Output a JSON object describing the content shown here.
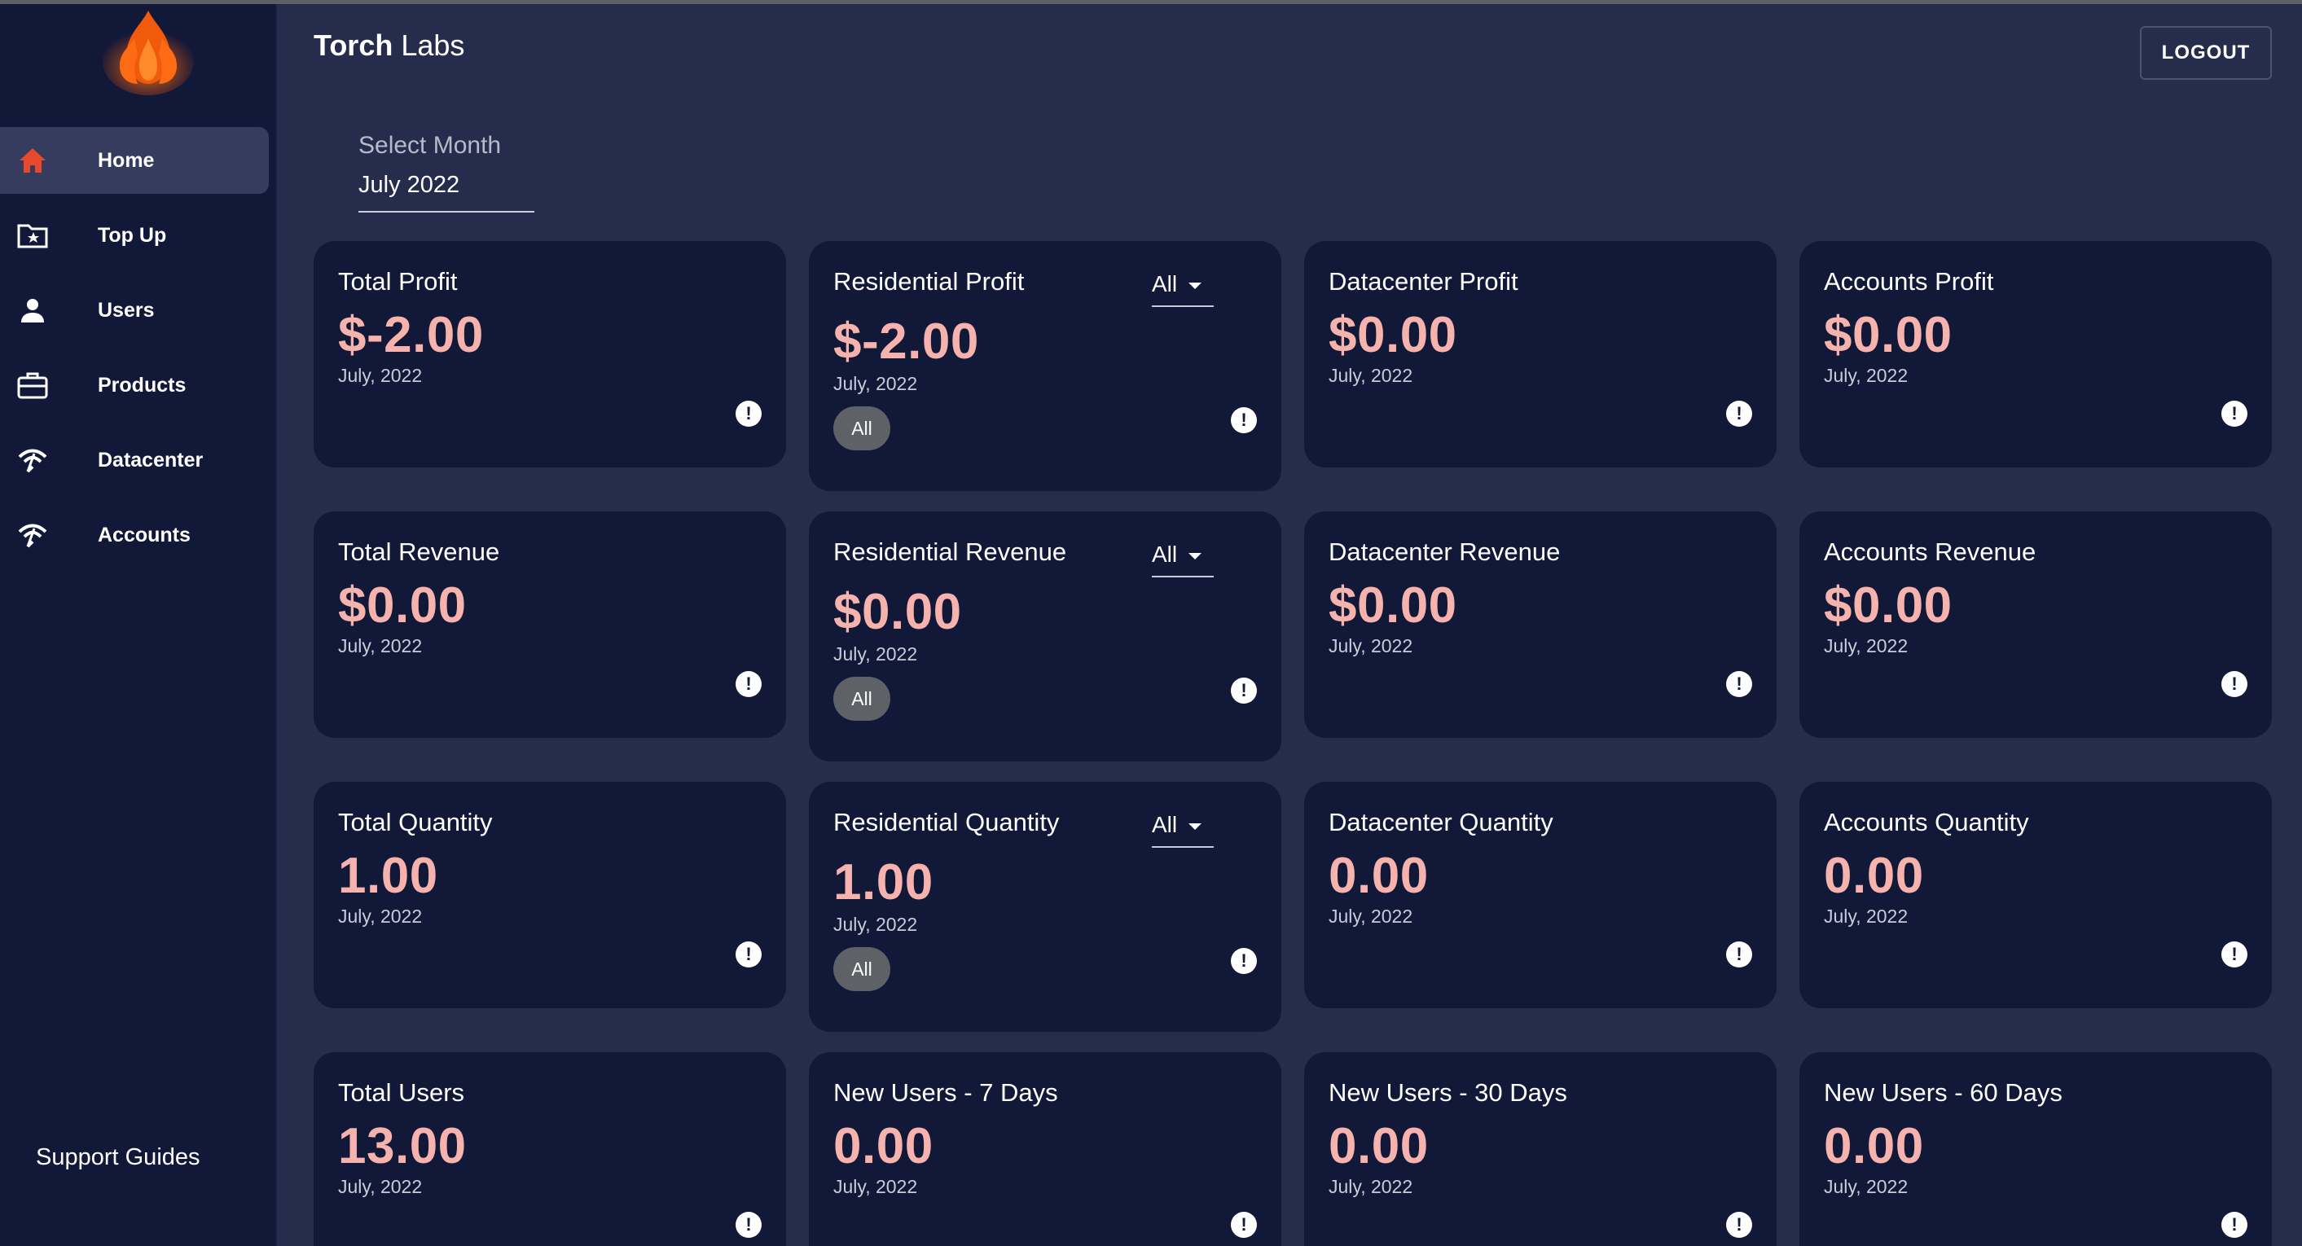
{
  "brand": {
    "bold": "Torch",
    "rest": " Labs"
  },
  "header": {
    "logout_label": "LOGOUT"
  },
  "sidebar": {
    "items": [
      {
        "label": "Home",
        "icon": "home-icon",
        "active": true
      },
      {
        "label": "Top Up",
        "icon": "folder-star-icon"
      },
      {
        "label": "Users",
        "icon": "user-icon"
      },
      {
        "label": "Products",
        "icon": "briefcase-icon"
      },
      {
        "label": "Datacenter",
        "icon": "wifi-icon"
      },
      {
        "label": "Accounts",
        "icon": "wifi-icon"
      }
    ],
    "support_label": "Support Guides"
  },
  "month": {
    "label": "Select Month",
    "value": "July 2022"
  },
  "colors": {
    "accent_value": "#f6b2ac",
    "card_bg": "#121838",
    "page_bg": "#262c4c",
    "active_icon": "#e8492c"
  },
  "cards": [
    {
      "title": "Total Profit",
      "value": "$-2.00",
      "date": "July, 2022"
    },
    {
      "title": "Residential Profit",
      "value": "$-2.00",
      "date": "July, 2022",
      "filter": "All",
      "chip": "All"
    },
    {
      "title": "Datacenter Profit",
      "value": "$0.00",
      "date": "July, 2022"
    },
    {
      "title": "Accounts Profit",
      "value": "$0.00",
      "date": "July, 2022"
    },
    {
      "title": "Total Revenue",
      "value": "$0.00",
      "date": "July, 2022"
    },
    {
      "title": "Residential Revenue",
      "value": "$0.00",
      "date": "July, 2022",
      "filter": "All",
      "chip": "All"
    },
    {
      "title": "Datacenter Revenue",
      "value": "$0.00",
      "date": "July, 2022"
    },
    {
      "title": "Accounts Revenue",
      "value": "$0.00",
      "date": "July, 2022"
    },
    {
      "title": "Total Quantity",
      "value": "1.00",
      "date": "July, 2022"
    },
    {
      "title": "Residential Quantity",
      "value": "1.00",
      "date": "July, 2022",
      "filter": "All",
      "chip": "All"
    },
    {
      "title": "Datacenter Quantity",
      "value": "0.00",
      "date": "July, 2022"
    },
    {
      "title": "Accounts Quantity",
      "value": "0.00",
      "date": "July, 2022"
    },
    {
      "title": "Total Users",
      "value": "13.00",
      "date": "July, 2022"
    },
    {
      "title": "New Users - 7 Days",
      "value": "0.00",
      "date": "July, 2022"
    },
    {
      "title": "New Users - 30 Days",
      "value": "0.00",
      "date": "July, 2022"
    },
    {
      "title": "New Users - 60 Days",
      "value": "0.00",
      "date": "July, 2022"
    }
  ]
}
